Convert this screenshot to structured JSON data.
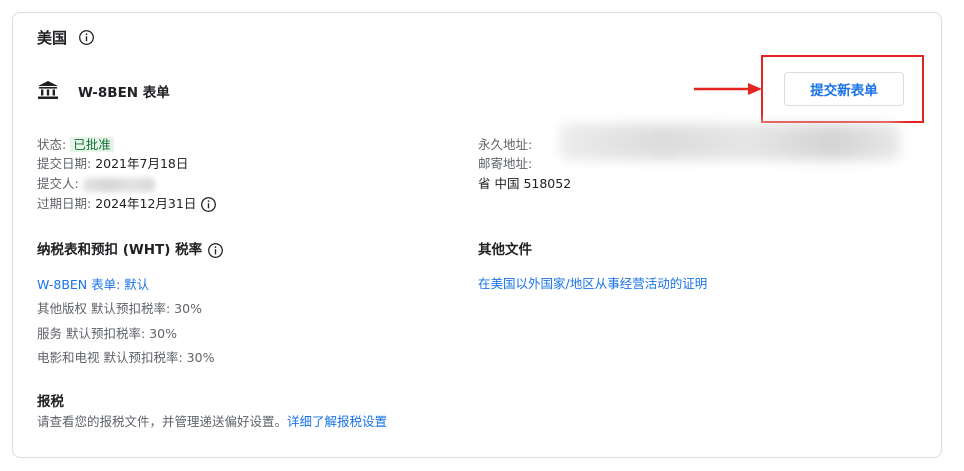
{
  "country": "美国",
  "form": {
    "title": "W-8BEN 表单",
    "submit_label": "提交新表单"
  },
  "details": {
    "status_label": "状态:",
    "status_value": "已批准",
    "submit_date_label": "提交日期:",
    "submit_date_value": "2021年7月18日",
    "submitter_label": "提交人:",
    "expiry_label": "过期日期:",
    "expiry_value": "2024年12月31日"
  },
  "address": {
    "permanent_label": "永久地址:",
    "mailing_label": "邮寄地址:",
    "mailing_line": "省 中国 518052"
  },
  "wht": {
    "title": "纳税表和预扣 (WHT) 税率",
    "form_link": "W-8BEN 表单: 默认",
    "rates": [
      "其他版权 默认预扣税率: 30%",
      "服务 默认预扣税率: 30%",
      "电影和电视 默认预扣税率: 30%"
    ]
  },
  "other_docs": {
    "title": "其他文件",
    "link": "在美国以外国家/地区从事经营活动的证明"
  },
  "tax_report": {
    "title": "报税",
    "text": "请查看您的报税文件，并管理递送偏好设置。",
    "link": "详细了解报税设置"
  },
  "colors": {
    "accent": "#1a73e8",
    "approved_bg": "#e6f4ea",
    "approved_text": "#137333",
    "annotation_red": "#e5231f"
  }
}
